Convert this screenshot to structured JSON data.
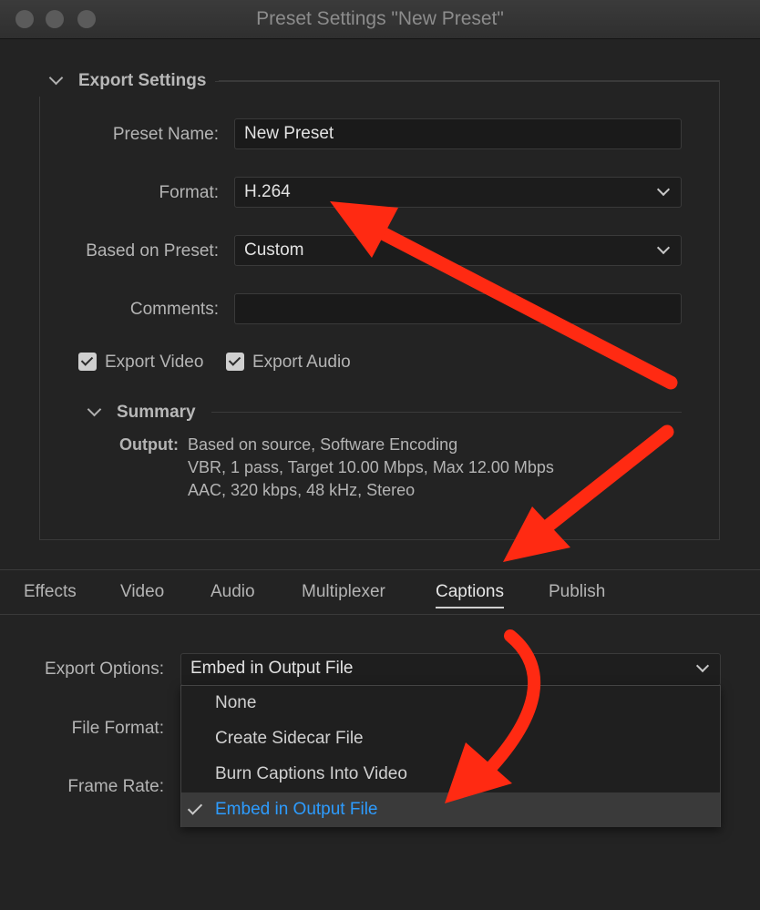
{
  "window": {
    "title": "Preset Settings \"New Preset\""
  },
  "export_settings": {
    "heading": "Export Settings",
    "preset_name_label": "Preset Name:",
    "preset_name_value": "New Preset",
    "format_label": "Format:",
    "format_value": "H.264",
    "based_on_label": "Based on Preset:",
    "based_on_value": "Custom",
    "comments_label": "Comments:",
    "comments_value": "",
    "export_video_label": "Export Video",
    "export_video_checked": true,
    "export_audio_label": "Export Audio",
    "export_audio_checked": true
  },
  "summary": {
    "heading": "Summary",
    "output_label": "Output:",
    "lines": [
      "Based on source, Software Encoding",
      "VBR, 1 pass, Target 10.00 Mbps, Max 12.00 Mbps",
      "AAC, 320 kbps, 48 kHz, Stereo"
    ]
  },
  "tabs": [
    {
      "label": "Effects",
      "active": false
    },
    {
      "label": "Video",
      "active": false
    },
    {
      "label": "Audio",
      "active": false
    },
    {
      "label": "Multiplexer",
      "active": false
    },
    {
      "label": "Captions",
      "active": true
    },
    {
      "label": "Publish",
      "active": false
    }
  ],
  "captions": {
    "export_options_label": "Export Options:",
    "export_options_value": "Embed in Output File",
    "file_format_label": "File Format:",
    "frame_rate_label": "Frame Rate:",
    "dropdown_options": [
      {
        "label": "None",
        "selected": false
      },
      {
        "label": "Create Sidecar File",
        "selected": false
      },
      {
        "label": "Burn Captions Into Video",
        "selected": false
      },
      {
        "label": "Embed in Output File",
        "selected": true
      }
    ]
  },
  "colors": {
    "annotation_arrow": "#ff2a12",
    "selected_option_text": "#2d9cff"
  }
}
